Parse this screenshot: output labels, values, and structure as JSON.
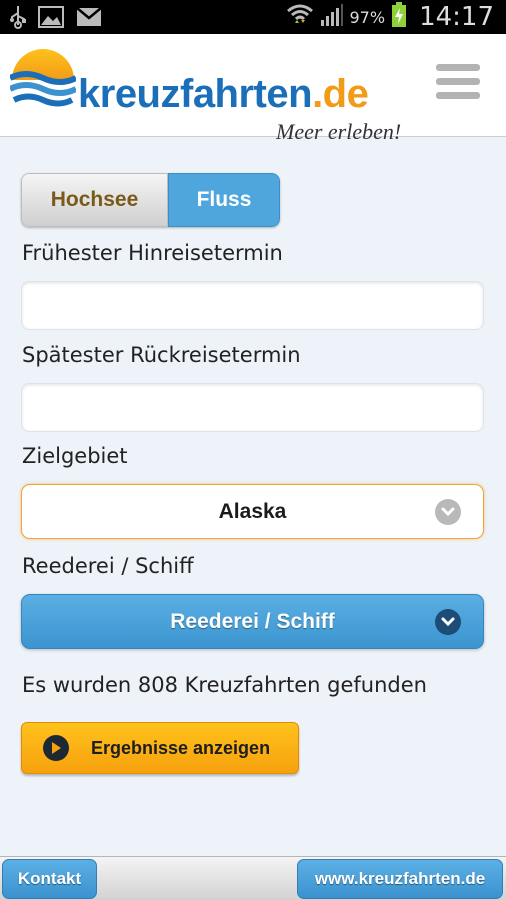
{
  "status_bar": {
    "battery_percent": "97%",
    "time": "14:17"
  },
  "header": {
    "logo_brand": "kreuzfahrten",
    "logo_tld": ".de",
    "slogan": "Meer erleben!"
  },
  "form": {
    "tabs": [
      {
        "label": "Hochsee",
        "active": false
      },
      {
        "label": "Fluss",
        "active": true
      }
    ],
    "earliest_departure_label": "Frühester Hinreisetermin",
    "earliest_departure_value": "",
    "latest_return_label": "Spätester Rückreisetermin",
    "latest_return_value": "",
    "destination_label": "Zielgebiet",
    "destination_value": "Alaska",
    "cruise_line_label": "Reederei / Schiff",
    "cruise_line_value": "Reederei / Schiff",
    "result_text": "Es wurden 808 Kreuzfahrten gefunden",
    "show_results_label": "Ergebnisse anzeigen"
  },
  "footer": {
    "contact_label": "Kontakt",
    "website_label": "www.kreuzfahrten.de"
  },
  "colors": {
    "brand_blue": "#1a6fb8",
    "brand_orange": "#f29b17",
    "button_blue": "#4fa6dc",
    "cta_yellow": "#ffc21c"
  }
}
